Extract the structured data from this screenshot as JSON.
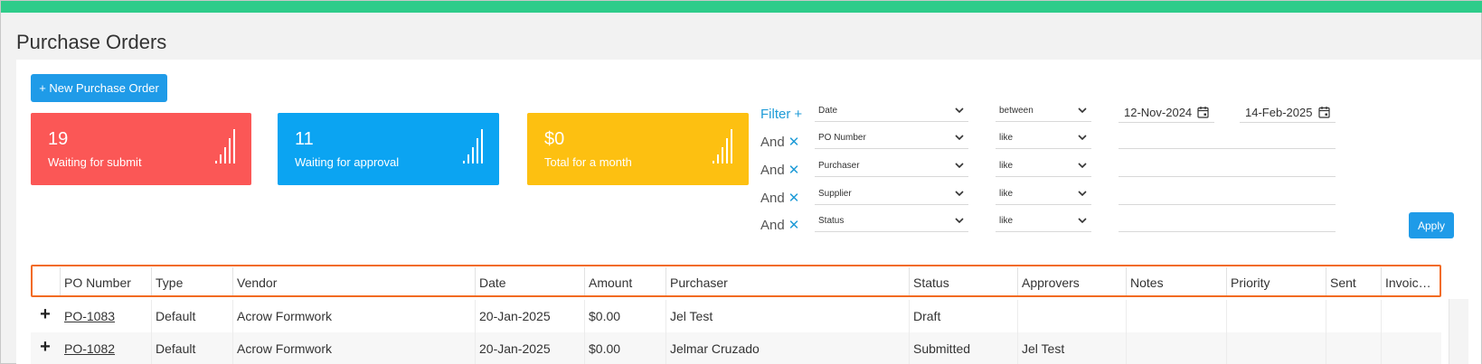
{
  "page": {
    "title": "Purchase Orders"
  },
  "toolbar": {
    "new_po_label": "+ New Purchase Order"
  },
  "cards": [
    {
      "value": "19",
      "label": "Waiting for submit",
      "color": "#fb5756"
    },
    {
      "value": "11",
      "label": "Waiting for approval",
      "color": "#0ba4f2"
    },
    {
      "value": "$0",
      "label": "Total for a month",
      "color": "#fdc011"
    }
  ],
  "filter": {
    "first_label": "Filter",
    "first_symbol": "+",
    "and_label": "And",
    "remove_symbol": "✕",
    "rows": [
      {
        "field": "Date",
        "operator": "between",
        "value_from": "12-Nov-2024",
        "value_to": "14-Feb-2025"
      },
      {
        "field": "PO Number",
        "operator": "like",
        "value": ""
      },
      {
        "field": "Purchaser",
        "operator": "like",
        "value": ""
      },
      {
        "field": "Supplier",
        "operator": "like",
        "value": ""
      },
      {
        "field": "Status",
        "operator": "like",
        "value": ""
      }
    ],
    "apply_label": "Apply"
  },
  "table": {
    "columns": [
      "PO Number",
      "Type",
      "Vendor",
      "Date",
      "Amount",
      "Purchaser",
      "Status",
      "Approvers",
      "Notes",
      "Priority",
      "Sent",
      "Invoic…"
    ],
    "expand_symbol": "+",
    "rows": [
      {
        "po": "PO-1083",
        "type": "Default",
        "vendor": "Acrow Formwork",
        "date": "20-Jan-2025",
        "amount": "$0.00",
        "purchaser": "Jel Test",
        "status": "Draft",
        "approvers": "",
        "notes": "",
        "priority": "",
        "sent": "",
        "invoice": ""
      },
      {
        "po": "PO-1082",
        "type": "Default",
        "vendor": "Acrow Formwork",
        "date": "20-Jan-2025",
        "amount": "$0.00",
        "purchaser": "Jelmar Cruzado",
        "status": "Submitted",
        "approvers": "Jel Test",
        "notes": "",
        "priority": "",
        "sent": "",
        "invoice": ""
      }
    ]
  },
  "colors": {
    "accent": "#1f9be8",
    "topbar": "#2ecc8a",
    "highlight": "#f26b22"
  }
}
